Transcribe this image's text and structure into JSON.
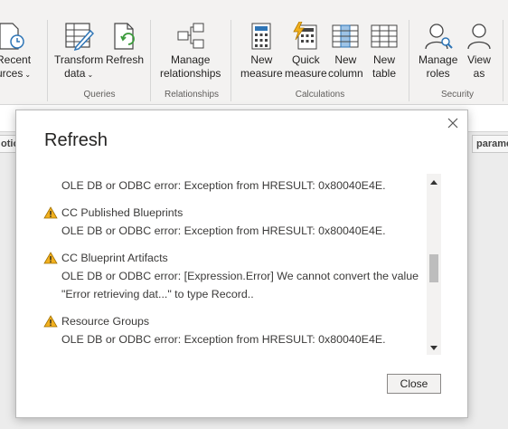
{
  "ribbon": {
    "recent_sources": {
      "line1": "Recent",
      "line2": "urces"
    },
    "transform_data": {
      "line1": "Transform",
      "line2": "data"
    },
    "refresh": {
      "line1": "Refresh"
    },
    "queries_label": "Queries",
    "manage_relationships": {
      "line1": "Manage",
      "line2": "relationships"
    },
    "relationships_label": "Relationships",
    "new_measure": {
      "line1": "New",
      "line2": "measure"
    },
    "quick_measure": {
      "line1": "Quick",
      "line2": "measure"
    },
    "new_column": {
      "line1": "New",
      "line2": "column"
    },
    "new_table": {
      "line1": "New",
      "line2": "table"
    },
    "calculations_label": "Calculations",
    "manage_roles": {
      "line1": "Manage",
      "line2": "roles"
    },
    "view_as": {
      "line1": "View",
      "line2": "as"
    },
    "security_label": "Security"
  },
  "background": {
    "chip_left": "otio",
    "chip_right": "parame"
  },
  "dialog": {
    "title": "Refresh",
    "close_button": "Close",
    "items": [
      {
        "name": "",
        "error": "OLE DB or ODBC error: Exception from HRESULT: 0x80040E4E."
      },
      {
        "name": "CC Published Blueprints",
        "error": "OLE DB or ODBC error: Exception from HRESULT: 0x80040E4E."
      },
      {
        "name": "CC Blueprint Artifacts",
        "error": "OLE DB or ODBC error: [Expression.Error] We cannot convert the value",
        "error2": "\"Error retrieving dat...\" to type Record.."
      },
      {
        "name": "Resource Groups",
        "error": "OLE DB or ODBC error: Exception from HRESULT: 0x80040E4E."
      }
    ]
  },
  "colors": {
    "accent": "#2e75b6",
    "warning": "#f2b01e",
    "ribbon_bg": "#f3f2f1"
  }
}
